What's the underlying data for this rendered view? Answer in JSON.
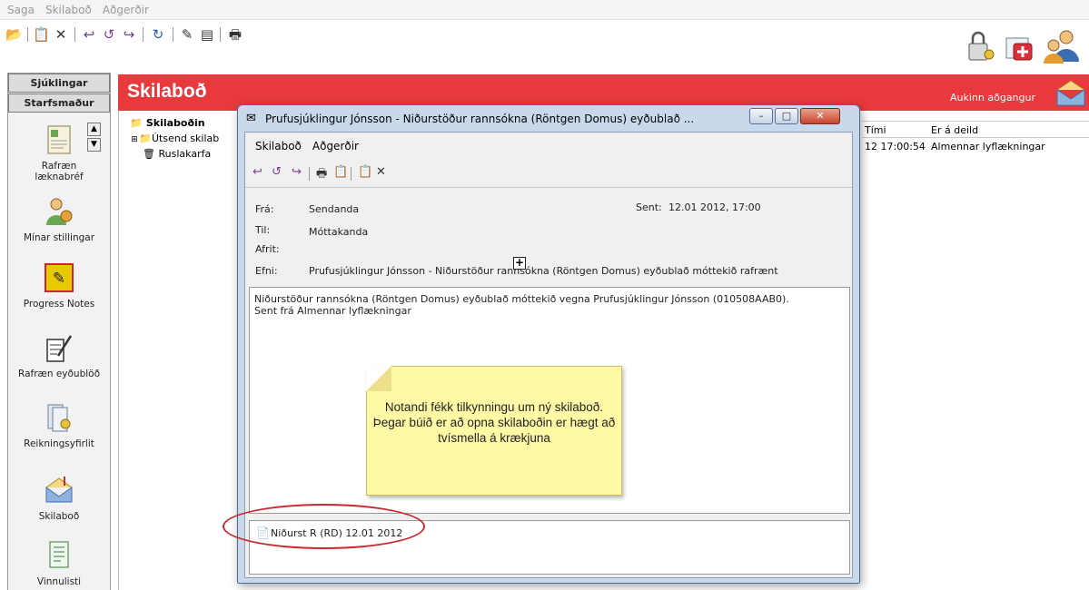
{
  "menubar": {
    "items": [
      "Saga",
      "Skilaboð",
      "Aðgerðir"
    ]
  },
  "toolbar": {
    "icons": [
      "open-icon",
      "new-message-icon",
      "delete-icon",
      "reply-icon",
      "reply-all-icon",
      "forward-icon",
      "refresh-icon",
      "edit-icon",
      "list-icon",
      "print-icon"
    ],
    "right_icons": [
      "lock-key-icon",
      "medical-card-icon",
      "users-icon"
    ]
  },
  "leftnav": {
    "tab_patients": "Sjúklingar",
    "tab_staff": "Starfsmaður",
    "items": [
      {
        "label": "Rafræn læknabréf",
        "icon": "letter-icon"
      },
      {
        "label": "Mínar stillingar",
        "icon": "user-settings-icon"
      },
      {
        "label": "Progress Notes",
        "icon": "progress-notes-icon"
      },
      {
        "label": "Rafræn eyðublöð",
        "icon": "form-pen-icon"
      },
      {
        "label": "Reikningsyfirlit",
        "icon": "ledger-icon"
      },
      {
        "label": "Skilaboð",
        "icon": "mail-icon"
      },
      {
        "label": "Vinnulisti",
        "icon": "worklist-icon"
      }
    ]
  },
  "main": {
    "title": "Skilaboð",
    "access_text": "Aukinn aðgangur",
    "tree": [
      "Skilaboðin",
      "Útsend skilab",
      "Ruslakarfa"
    ],
    "columns": [
      "Tími",
      "Er á deild"
    ],
    "row": {
      "time": "12 17:00:54",
      "department": "Almennar lyflækningar"
    }
  },
  "message_window": {
    "title": "Prufusjúklingur Jónsson - Niðurstöður rannsókna (Röntgen Domus) eyðublað ...",
    "menu": [
      "Skilaboð",
      "Aðgerðir"
    ],
    "labels": {
      "from": "Frá:",
      "to": "Til:",
      "cc": "Afrit:",
      "subject": "Efni:",
      "sent": "Sent:"
    },
    "from": "Sendanda",
    "to": "Móttakanda",
    "cc": "",
    "sent": "12.01 2012, 17:00",
    "subject": "Prufusjúklingur Jónsson - Niðurstöður rannsókna (Röntgen Domus) eyðublað móttekið rafrænt",
    "body_line1": "Niðurstöður rannsókna (Röntgen Domus) eyðublað móttekið vegna Prufusjúklingur Jónsson (010508AAB0).",
    "body_line2": "Sent frá Almennar lyflækningar",
    "attachment": "Niðurst R (RD) 12.01 2012"
  },
  "note": {
    "text": "Notandi fékk tilkynningu um ný skilaboð.  Þegar búið er að opna skilaboðin er hægt að tvísmella á krækjuna"
  },
  "colors": {
    "header_red": "#e8393c",
    "note_yellow": "#fff9a6",
    "ellipse_red": "#c8282f"
  }
}
